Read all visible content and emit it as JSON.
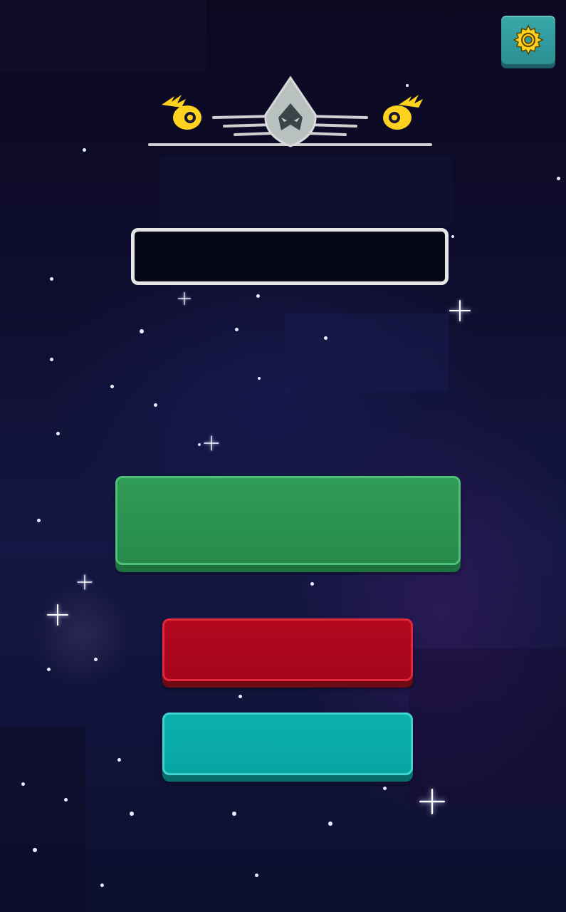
{
  "settings": {
    "icon": "gear-icon",
    "icon_color": "#ffd21f",
    "button_color": "#2f9b9e"
  },
  "emblem": {
    "icons": [
      "comet-icon",
      "hooded-ship-icon",
      "comet-icon"
    ],
    "wing_color": "#c9c9c9",
    "comet_color": "#ffd21f"
  },
  "name_input": {
    "value": "",
    "placeholder": ""
  },
  "buttons": {
    "play_label": "",
    "red_label": "",
    "teal_label": "",
    "play_color": "#2a8f4d",
    "red_color": "#ab061c",
    "teal_color": "#08aaa7"
  },
  "background": {
    "color": "#0f0d2e",
    "stars_color": "#ffffff"
  }
}
